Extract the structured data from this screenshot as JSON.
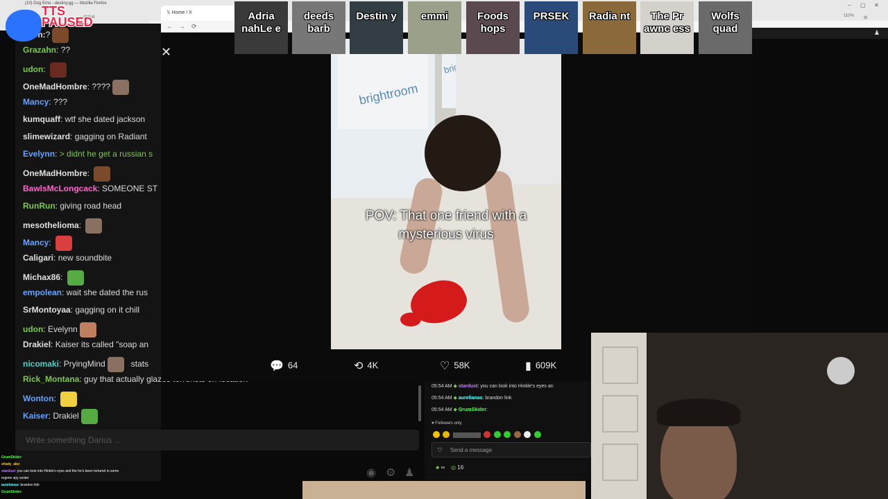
{
  "browser": {
    "first_tab": "(10) Dog Emo - destiny.gg — Mozilla Firefox",
    "active_tab": "Home / X",
    "url_fragment": "d/chat",
    "zoom": "110%"
  },
  "tts": {
    "line1": "TTS",
    "line2": "PAUSED"
  },
  "streamers": [
    {
      "name": "Adria nahLe e",
      "color": "#3a3a3a"
    },
    {
      "name": "deeds barb",
      "color": "#777777"
    },
    {
      "name": "Destin y",
      "color": "#333d44"
    },
    {
      "name": "emmi",
      "color": "#9aa08a"
    },
    {
      "name": "Foods hops",
      "color": "#5a4a50"
    },
    {
      "name": "PRSEK",
      "color": "#2a4a7a"
    },
    {
      "name": "Radia nt",
      "color": "#8a6a3a"
    },
    {
      "name": "The Pr awnc ess",
      "color": "#d4d0cc"
    },
    {
      "name": "Wolfs quad",
      "color": "#6a6a6a"
    }
  ],
  "chat": {
    "messages": [
      {
        "user": "ation:",
        "text": "?",
        "color": "#dcdcdc"
      },
      {
        "user": "Grazahn",
        "text": "??",
        "color": "#7ec850"
      },
      {
        "user": "udon",
        "text": "",
        "color": "#7ec850"
      },
      {
        "user": "OneMadHombre",
        "text": "????",
        "color": "#e0e0e0"
      },
      {
        "user": "Mancy",
        "text": "???",
        "color": "#66a3ff"
      },
      {
        "user": "kumquaff",
        "text": "wtf she dated jackson",
        "color": "#e0e0e0"
      },
      {
        "user": "slimewizard",
        "text": "gagging on Radiant",
        "color": "#e0e0e0"
      },
      {
        "user": "Evelynn",
        "text": "> didnt he get a russian s",
        "color": "#66a3ff",
        "greentext": true
      },
      {
        "user": "OneMadHombre",
        "text": "",
        "color": "#e0e0e0"
      },
      {
        "user": "BawlsMcLongcack",
        "text": "SOMEONE ST",
        "color": "#ff66cc"
      },
      {
        "user": "RunRun",
        "text": "giving road head",
        "color": "#7ec850"
      },
      {
        "user": "mesothelioma",
        "text": "",
        "color": "#e0e0e0"
      },
      {
        "user": "Mancy",
        "text": "",
        "color": "#66a3ff"
      },
      {
        "user": "Caligari",
        "text": "new soundbite",
        "color": "#e0e0e0"
      },
      {
        "user": "Michax86",
        "text": "",
        "color": "#e0e0e0"
      },
      {
        "user": "empolean",
        "text": "wait she dated the rus",
        "color": "#66a3ff"
      },
      {
        "user": "SrMontoyaa",
        "text": "gagging on it chill",
        "color": "#e0e0e0"
      },
      {
        "user": "udon",
        "text": "Evelynn",
        "color": "#7ec850"
      },
      {
        "user": "Drakiel",
        "text": "Kaiser its called \"soap an",
        "color": "#e0e0e0"
      },
      {
        "user": "nicomaki",
        "text": "PryingMind",
        "color": "#4fd1c5",
        "tail": "stats"
      },
      {
        "user": "Rick_Montana",
        "text": "guy that actually glazes terrorists on location",
        "color": "#7ec850"
      },
      {
        "user": "Wonton",
        "text": "",
        "color": "#66a3ff"
      },
      {
        "user": "Kaiser",
        "text": "Drakiel",
        "color": "#66a3ff"
      }
    ],
    "placeholder": "Write something Darius ..."
  },
  "tweet": {
    "caption_line1": "POV: That one friend with a",
    "caption_line2": "mysterious virus",
    "box_brand": "brightroom",
    "replies": "64",
    "reposts": "4K",
    "likes": "58K",
    "views": "609K"
  },
  "twitch_chat": {
    "lines": [
      {
        "time": "05:54 AM",
        "user": "stardust",
        "text": ": you can look into Hinkle's eyes an",
        "color": "#c080ff"
      },
      {
        "time": "05:54 AM",
        "user": "aurelianas",
        "text": ": brandon link",
        "color": "#66ffff"
      },
      {
        "time": "05:54 AM",
        "user": "GrumSkider",
        "text": ":",
        "color": "#55ff55"
      }
    ],
    "followers_only": "Followers only",
    "send_placeholder": "Send a message",
    "points": "16",
    "infinity": "∞"
  },
  "mini_chat": [
    {
      "user": "GrumSkider",
      "text": ":",
      "color": "#55ff55"
    },
    {
      "user": "shady_abe",
      "text": ":",
      "color": "#ffcc33"
    },
    {
      "user": "stardust",
      "text": ": you can look into Hinkle's eyes and the he's been tortured in some",
      "color": "#c080ff"
    },
    {
      "user": "",
      "text": "regime spy center",
      "color": "#ffffff"
    },
    {
      "user": "aurelianas",
      "text": ": brandon link",
      "color": "#66ffff"
    },
    {
      "user": "GrumSkider",
      "text": ":",
      "color": "#55ff55"
    }
  ]
}
